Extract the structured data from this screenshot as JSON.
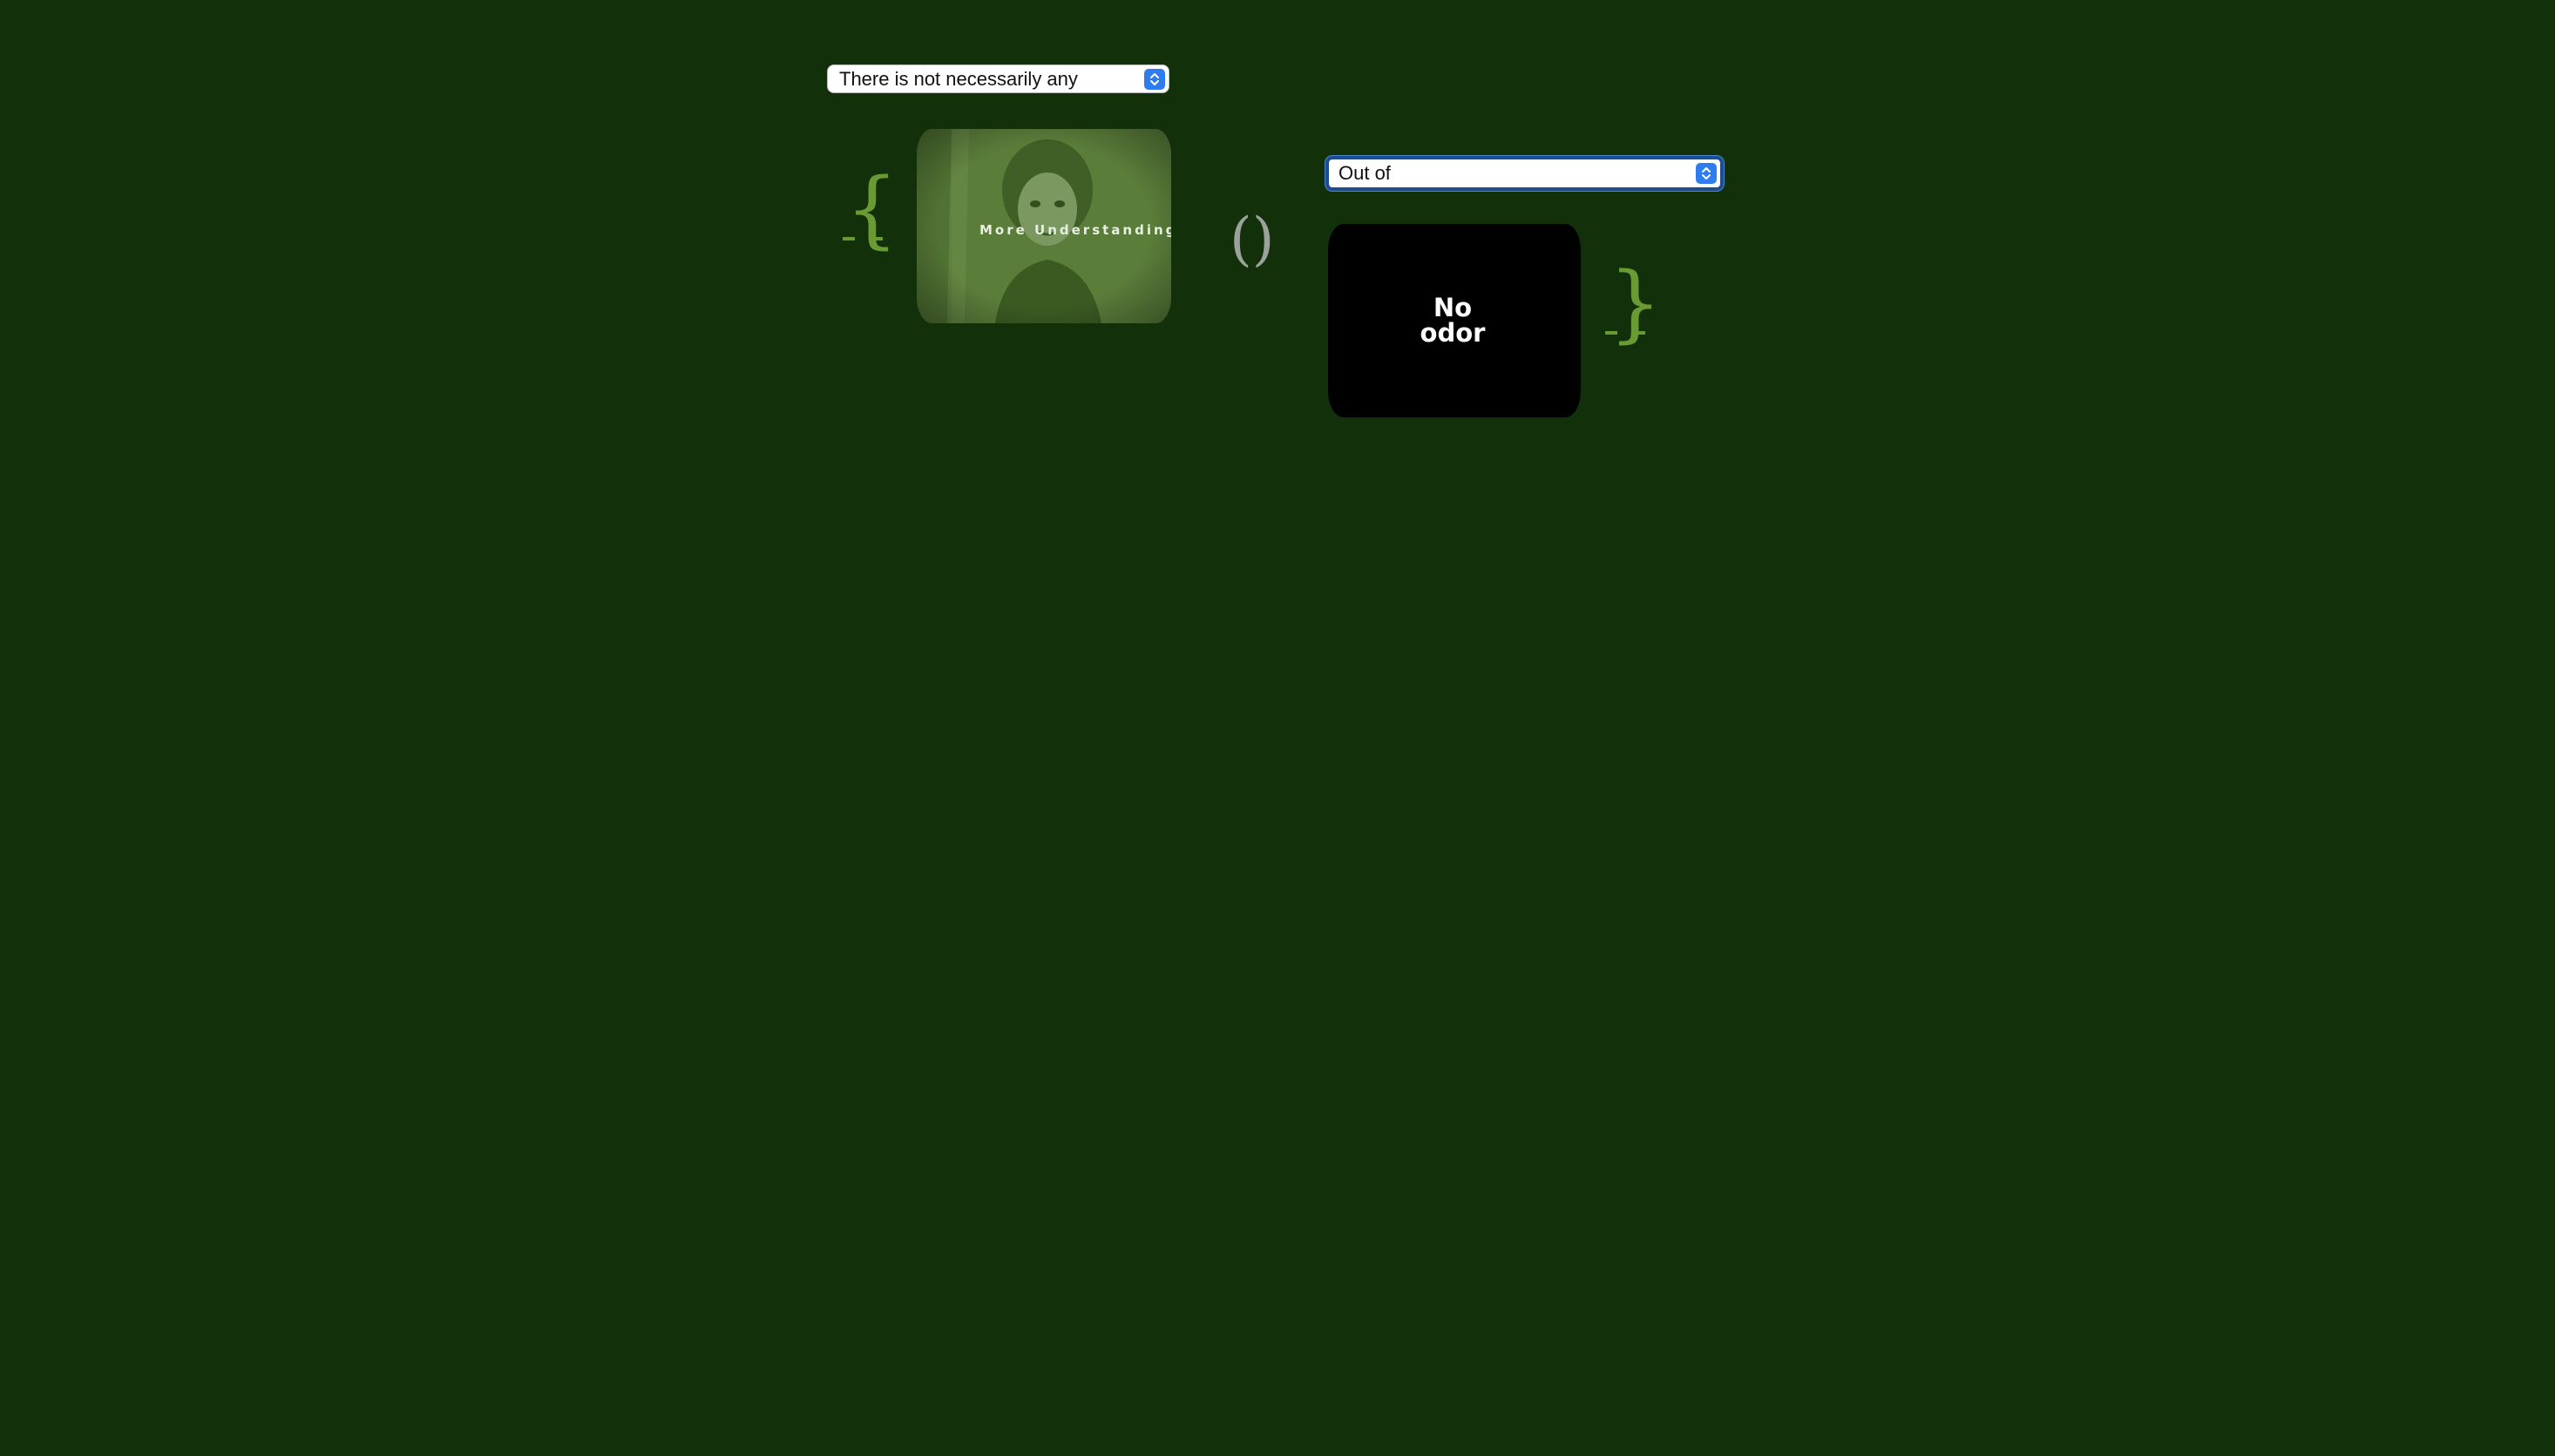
{
  "selects": {
    "first": {
      "value": "There is not necessarily any"
    },
    "second": {
      "value": "Out of"
    }
  },
  "brackets": {
    "open_brace": "{",
    "close_brace": "}",
    "parens": "()"
  },
  "screens": {
    "video": {
      "caption": "More Understanding"
    },
    "black": {
      "caption": "No odor"
    }
  },
  "icons": {
    "select_arrow": "up-down-chevron-icon"
  },
  "colors": {
    "background": "#12310a",
    "brace": "#6a9a33",
    "paren": "#9aa29a",
    "select_accent": "#2f7cf0",
    "focus_ring": "#1d4d8f"
  }
}
